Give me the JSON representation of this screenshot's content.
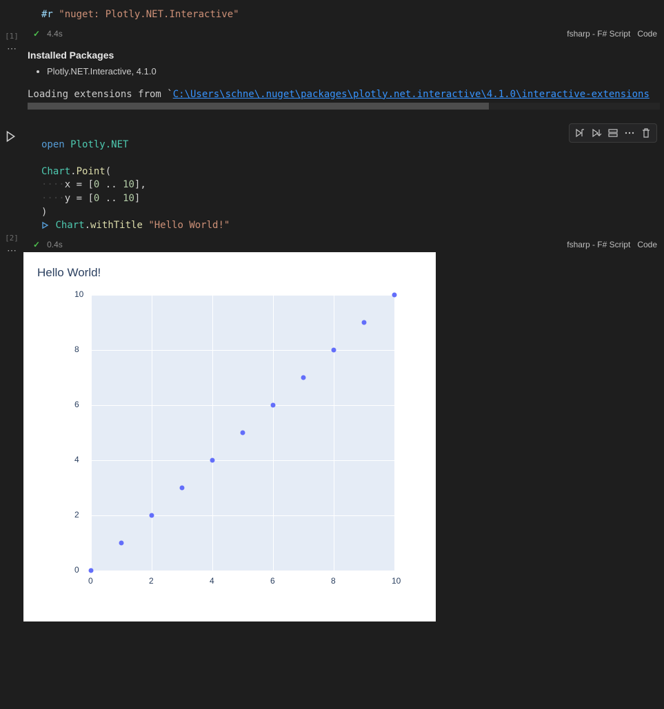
{
  "cell1": {
    "exec_count": "[1]",
    "code": {
      "directive": "#r",
      "space": " ",
      "string": "\"nuget: Plotly.NET.Interactive\""
    },
    "status": {
      "check": "✓",
      "time": "4.4s",
      "lang": "fsharp - F# Script",
      "kind": "Code"
    },
    "out_heading": "Installed Packages",
    "out_package": "Plotly.NET.Interactive, 4.1.0",
    "loading_prefix": "Loading extensions from `",
    "loading_path": "C:\\Users\\schne\\.nuget\\packages\\plotly.net.interactive\\4.1.0\\interactive-extensions"
  },
  "cell2": {
    "exec_count": "[2]",
    "code": {
      "l1_kw": "open",
      "l1_sp": " ",
      "l1_mod": "Plotly.NET",
      "l3_typ": "Chart",
      "l3_dot": ".",
      "l3_fn": "Point",
      "l3_op": "(",
      "l4_ws": "····",
      "l4_id": "x",
      "l4_sp": " ",
      "l4_eq": "=",
      "l4_sp2": " ",
      "l4_lb": "[",
      "l4_n0": "0",
      "l4_dd": " .. ",
      "l4_n1": "10",
      "l4_rb": "]",
      "l4_c": ",",
      "l5_ws": "····",
      "l5_id": "y",
      "l5_sp": " ",
      "l5_eq": "=",
      "l5_sp2": " ",
      "l5_lb": "[",
      "l5_n0": "0",
      "l5_dd": " .. ",
      "l5_n1": "10",
      "l5_rb": "]",
      "l6_cp": ")",
      "l7_pipe": "|>",
      "l7_sp": " ",
      "l7_typ": "Chart",
      "l7_dot": ".",
      "l7_fn": "withTitle",
      "l7_sp2": " ",
      "l7_str": "\"Hello World!\""
    },
    "status": {
      "check": "✓",
      "time": "0.4s",
      "lang": "fsharp - F# Script",
      "kind": "Code"
    }
  },
  "chart_data": {
    "type": "scatter",
    "title": "Hello World!",
    "x": [
      0,
      1,
      2,
      3,
      4,
      5,
      6,
      7,
      8,
      9,
      10
    ],
    "y": [
      0,
      1,
      2,
      3,
      4,
      5,
      6,
      7,
      8,
      9,
      10
    ],
    "xlim": [
      0,
      10
    ],
    "ylim": [
      0,
      10
    ],
    "xticks": [
      0,
      2,
      4,
      6,
      8,
      10
    ],
    "yticks": [
      0,
      2,
      4,
      6,
      8,
      10
    ],
    "xlabel": "",
    "ylabel": ""
  },
  "toolbar": {
    "run_above": "run-cell-above",
    "run_below": "run-cell-below",
    "split": "split-cell",
    "more": "more-actions",
    "delete": "delete-cell"
  }
}
